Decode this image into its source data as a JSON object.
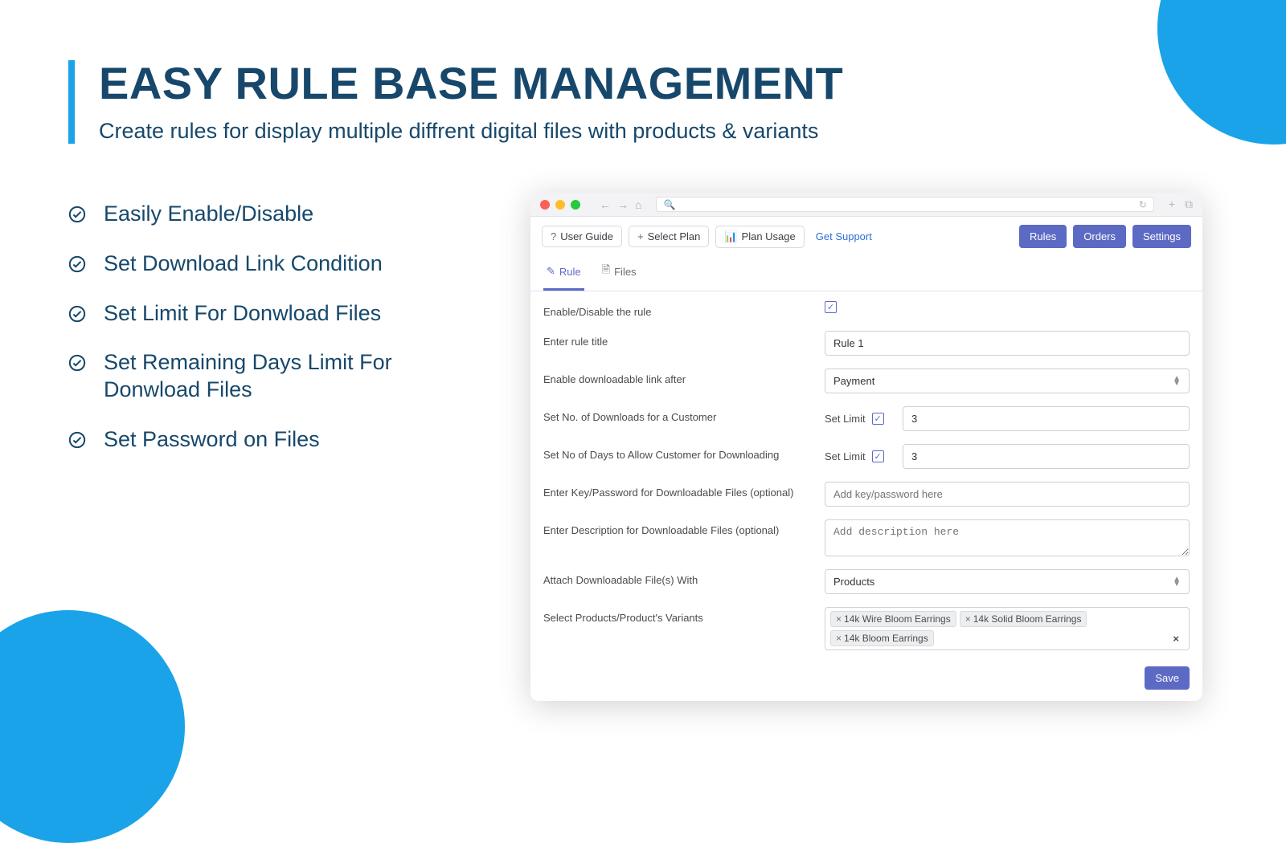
{
  "page": {
    "heading": "EASY RULE BASE MANAGEMENT",
    "subheading": "Create rules for display multiple diffrent digital files with products & variants"
  },
  "features": [
    "Easily Enable/Disable",
    "Set Download Link Condition",
    "Set Limit For Donwload Files",
    "Set Remaining Days Limit For Donwload Files",
    "Set Password on Files"
  ],
  "appbar": {
    "user_guide": "User Guide",
    "select_plan": "Select Plan",
    "plan_usage": "Plan Usage",
    "get_support": "Get Support",
    "rules": "Rules",
    "orders": "Orders",
    "settings": "Settings"
  },
  "tabs": {
    "rule": "Rule",
    "files": "Files"
  },
  "form": {
    "enable_label": "Enable/Disable the rule",
    "enable_checked": true,
    "title_label": "Enter rule title",
    "title_value": "Rule 1",
    "link_after_label": "Enable downloadable link after",
    "link_after_value": "Payment",
    "downloads_label": "Set No. of Downloads for a Customer",
    "setlimit_label": "Set Limit",
    "downloads_limit_checked": true,
    "downloads_limit_value": "3",
    "days_label": "Set No of Days to Allow Customer for Downloading",
    "days_limit_checked": true,
    "days_limit_value": "3",
    "key_label": "Enter Key/Password for Downloadable Files (optional)",
    "key_placeholder": "Add key/password here",
    "desc_label": "Enter Description for Downloadable Files (optional)",
    "desc_placeholder": "Add description here",
    "attach_label": "Attach Downloadable File(s) With",
    "attach_value": "Products",
    "select_products_label": "Select Products/Product's Variants",
    "tags": [
      "14k Wire Bloom Earrings",
      "14k Solid Bloom Earrings",
      "14k Bloom Earrings"
    ],
    "save_label": "Save"
  }
}
